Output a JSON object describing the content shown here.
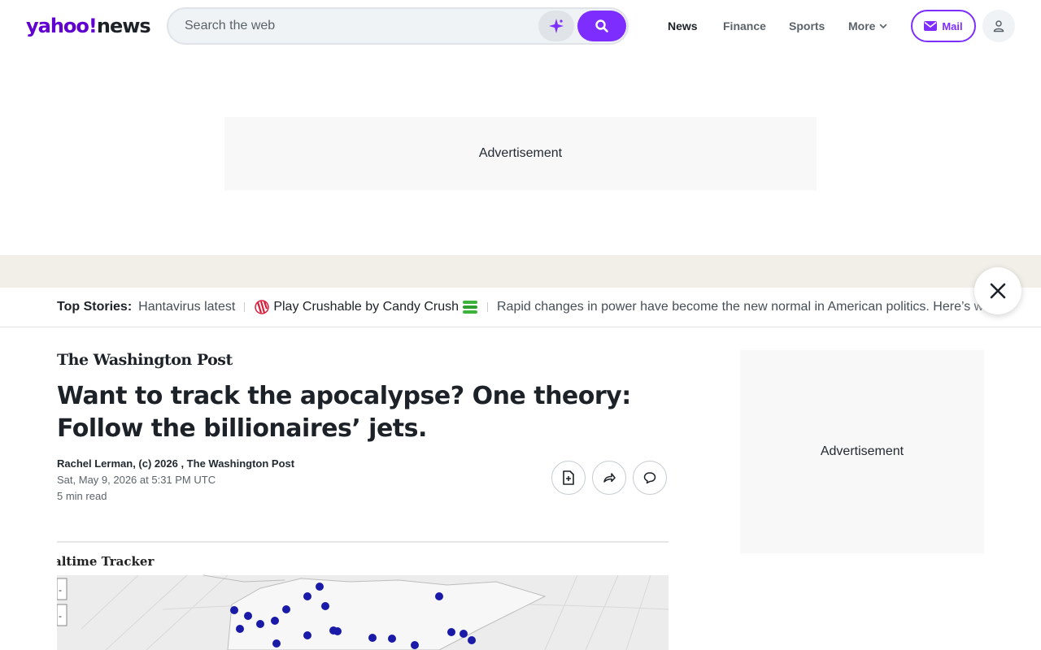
{
  "header": {
    "logo": {
      "yahoo": "yahoo!",
      "news": "news"
    },
    "search": {
      "placeholder": "Search the web"
    },
    "nav": [
      "News",
      "Finance",
      "Sports",
      "More"
    ],
    "mail_label": "Mail",
    "accent": "#7d2eff"
  },
  "ads": {
    "top": "Advertisement",
    "side": "Advertisement"
  },
  "ticker": {
    "label": "Top Stories:",
    "items": [
      "Hantavirus latest",
      "Play Crushable by Candy Crush",
      "Rapid changes in power have become the new normal in American politics. Here’s why"
    ]
  },
  "article": {
    "source": "The Washington Post",
    "headline": "Want to track the apocalypse? One theory: Follow the billionaires’ jets.",
    "byline": "Rachel Lerman, (c) 2026 , The Washington Post",
    "date": "Sat, May 9, 2026 at 5:31 PM UTC",
    "read_time": "5 min read"
  },
  "hero_image": {
    "caption_title": "altime Tracker"
  }
}
